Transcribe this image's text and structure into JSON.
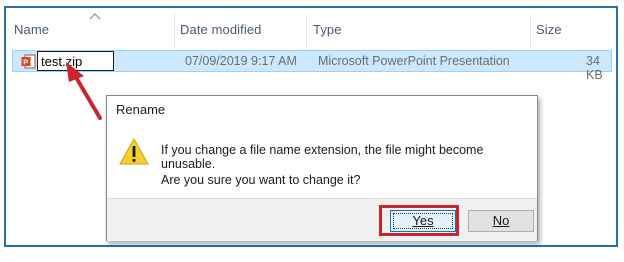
{
  "explorer": {
    "columns": {
      "name": "Name",
      "date_modified": "Date modified",
      "type": "Type",
      "size": "Size"
    },
    "file": {
      "name_edit_value": "test.zip",
      "date_modified": "07/09/2019 9:17 AM",
      "type": "Microsoft PowerPoint Presentation",
      "size": "34 KB",
      "icon": "powerpoint-file-icon"
    }
  },
  "dialog": {
    "title": "Rename",
    "icon": "warning-icon",
    "message_line1": "If you change a file name extension, the file might become unusable.",
    "message_line2": "Are you sure you want to change it?",
    "yes_label": "Yes",
    "no_label": "No"
  },
  "colors": {
    "frame_border": "#2d6fa8",
    "selection": "#cce8ff",
    "annotation_red": "#c8252c",
    "warning_yellow": "#f7d12d"
  }
}
